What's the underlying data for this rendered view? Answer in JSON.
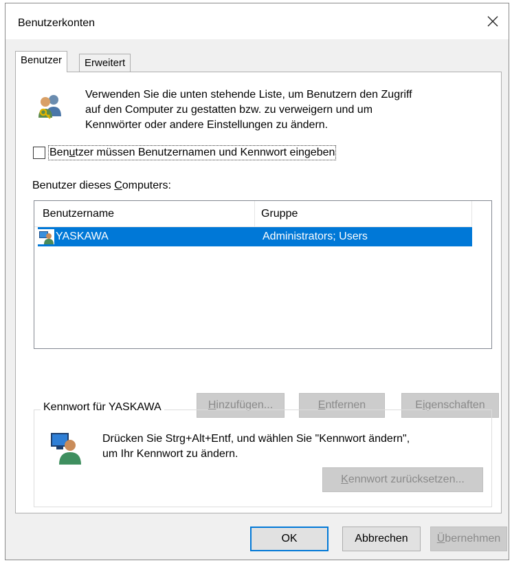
{
  "window": {
    "title": "Benutzerkonten"
  },
  "tabs": [
    {
      "label": "Benutzer",
      "active": true
    },
    {
      "label": "Erweitert",
      "active": false
    }
  ],
  "info": {
    "line1": "Verwenden Sie die unten stehende Liste, um Benutzern den Zugriff",
    "line2": "auf den Computer zu gestatten bzw. zu verweigern und um",
    "line3": "Kennwörter oder andere Einstellungen zu ändern.",
    "icon": "users-key-icon"
  },
  "checkbox": {
    "label_pre": "Ben",
    "label_u": "u",
    "label_post": "tzer müssen Benutzernamen und Kennwort eingeben",
    "checked": false
  },
  "users_list": {
    "label_pre": "Benutzer dieses ",
    "label_u": "C",
    "label_post": "omputers:",
    "columns": [
      "Benutzername",
      "Gruppe"
    ],
    "rows": [
      {
        "username": "YASKAWA",
        "group": "Administrators; Users",
        "selected": true
      }
    ]
  },
  "list_buttons": {
    "add": {
      "u": "H",
      "rest": "inzufügen..."
    },
    "remove": {
      "u": "E",
      "rest": "ntfernen"
    },
    "properties": {
      "pre": "E",
      "u": "i",
      "rest": "genschaften"
    }
  },
  "password_group": {
    "legend": "Kennwort für YASKAWA",
    "line1": "Drücken Sie Strg+Alt+Entf, und wählen Sie \"Kennwort ändern\",",
    "line2": "um Ihr Kennwort zu ändern.",
    "reset_button": {
      "u": "K",
      "rest": "ennwort zurücksetzen..."
    },
    "icon": "user-monitor-icon"
  },
  "dialog_buttons": {
    "ok": "OK",
    "cancel": "Abbrechen",
    "apply": {
      "u": "Ü",
      "rest": "bernehmen"
    }
  },
  "colors": {
    "selection": "#0078d7",
    "disabled_button": "#cccccc",
    "client_bg": "#f0f0f0"
  }
}
